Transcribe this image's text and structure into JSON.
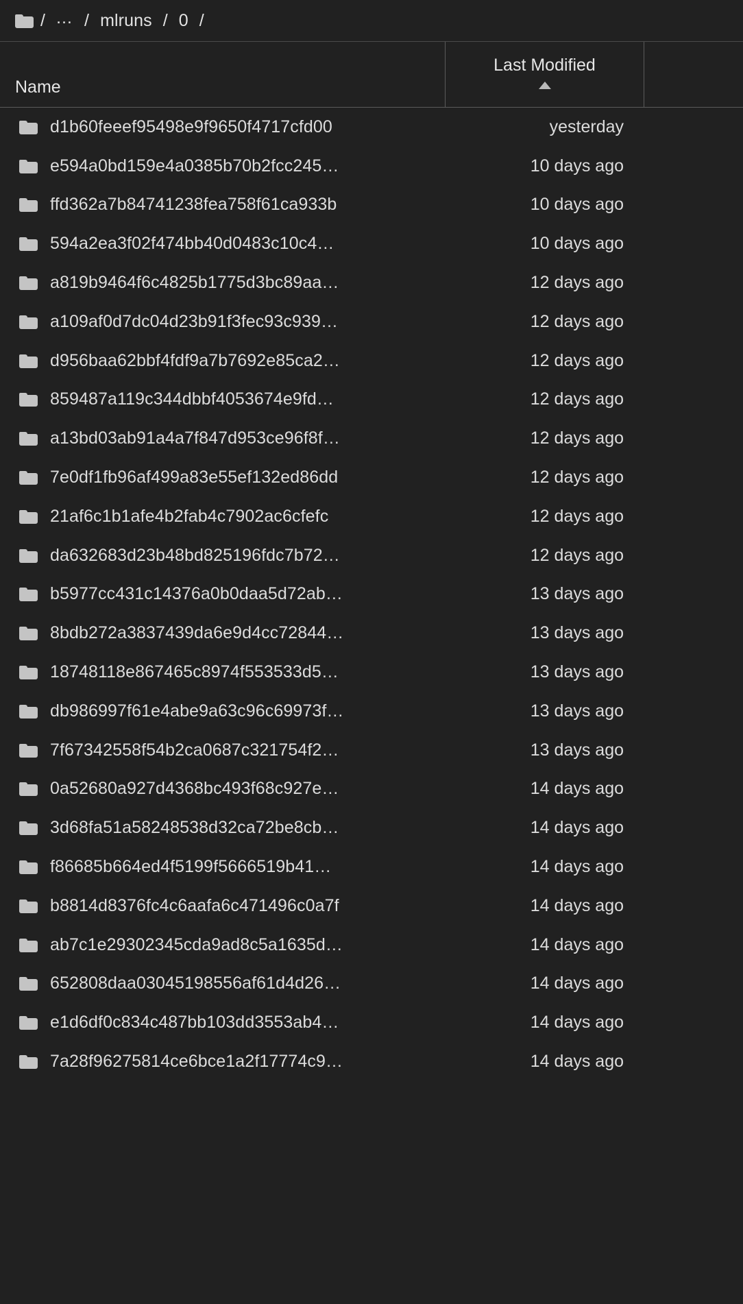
{
  "breadcrumb": {
    "folder_icon": "folder-icon",
    "separator": "/",
    "ellipsis": "…",
    "segments": [
      "mlruns",
      "0"
    ],
    "trailing_separator": "/"
  },
  "columns": {
    "name_label": "Name",
    "last_modified_label": "Last Modified",
    "sort_indicator": "ascending-caret-icon"
  },
  "colors": {
    "background": "#212121",
    "text": "#dcdcdc",
    "border": "#5b5b5b",
    "folder_icon": "#c4c4c4"
  },
  "files": [
    {
      "name": "d1b60feeef95498e9f9650f4717cfd00",
      "modified": "yesterday"
    },
    {
      "name": "e594a0bd159e4a0385b70b2fcc245…",
      "modified": "10 days ago"
    },
    {
      "name": "ffd362a7b84741238fea758f61ca933b",
      "modified": "10 days ago"
    },
    {
      "name": "594a2ea3f02f474bb40d0483c10c4…",
      "modified": "10 days ago"
    },
    {
      "name": "a819b9464f6c4825b1775d3bc89aa…",
      "modified": "12 days ago"
    },
    {
      "name": "a109af0d7dc04d23b91f3fec93c939…",
      "modified": "12 days ago"
    },
    {
      "name": "d956baa62bbf4fdf9a7b7692e85ca2…",
      "modified": "12 days ago"
    },
    {
      "name": "859487a119c344dbbf4053674e9fd…",
      "modified": "12 days ago"
    },
    {
      "name": "a13bd03ab91a4a7f847d953ce96f8f…",
      "modified": "12 days ago"
    },
    {
      "name": "7e0df1fb96af499a83e55ef132ed86dd",
      "modified": "12 days ago"
    },
    {
      "name": "21af6c1b1afe4b2fab4c7902ac6cfefc",
      "modified": "12 days ago"
    },
    {
      "name": "da632683d23b48bd825196fdc7b72…",
      "modified": "12 days ago"
    },
    {
      "name": "b5977cc431c14376a0b0daa5d72ab…",
      "modified": "13 days ago"
    },
    {
      "name": "8bdb272a3837439da6e9d4cc72844…",
      "modified": "13 days ago"
    },
    {
      "name": "18748118e867465c8974f553533d5…",
      "modified": "13 days ago"
    },
    {
      "name": "db986997f61e4abe9a63c96c69973f…",
      "modified": "13 days ago"
    },
    {
      "name": "7f67342558f54b2ca0687c321754f2…",
      "modified": "13 days ago"
    },
    {
      "name": "0a52680a927d4368bc493f68c927e…",
      "modified": "14 days ago"
    },
    {
      "name": "3d68fa51a58248538d32ca72be8cb…",
      "modified": "14 days ago"
    },
    {
      "name": "f86685b664ed4f5199f5666519b41…",
      "modified": "14 days ago"
    },
    {
      "name": "b8814d8376fc4c6aafa6c471496c0a7f",
      "modified": "14 days ago"
    },
    {
      "name": "ab7c1e29302345cda9ad8c5a1635d…",
      "modified": "14 days ago"
    },
    {
      "name": "652808daa03045198556af61d4d26…",
      "modified": "14 days ago"
    },
    {
      "name": "e1d6df0c834c487bb103dd3553ab4…",
      "modified": "14 days ago"
    },
    {
      "name": "7a28f96275814ce6bce1a2f17774c9…",
      "modified": "14 days ago"
    }
  ]
}
